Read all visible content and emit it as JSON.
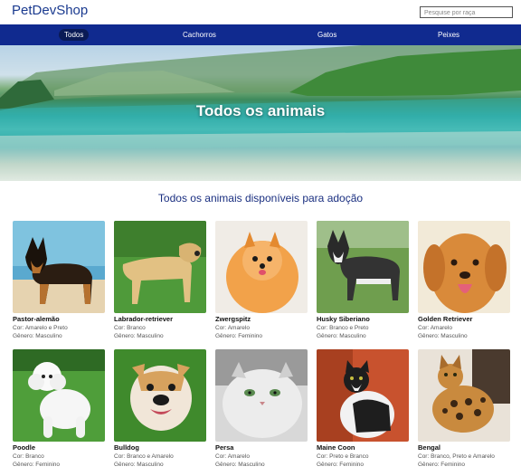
{
  "header": {
    "brand": "PetDevShop",
    "search_placeholder": "Pesquise por raça"
  },
  "nav": {
    "items": [
      {
        "label": "Todos",
        "active": true
      },
      {
        "label": "Cachorros",
        "active": false
      },
      {
        "label": "Gatos",
        "active": false
      },
      {
        "label": "Peixes",
        "active": false
      }
    ]
  },
  "hero": {
    "title": "Todos os animais"
  },
  "section": {
    "title": "Todos os animais disponíveis para adoção"
  },
  "animals": [
    {
      "name": "Pastor-alemão",
      "color": "Cor: Amarelo e Preto",
      "gender": "Gênero: Masculino",
      "icon": "german-shepherd-photo"
    },
    {
      "name": "Labrador-retriever",
      "color": "Cor: Branco",
      "gender": "Gênero: Masculino",
      "icon": "labrador-photo"
    },
    {
      "name": "Zwergspitz",
      "color": "Cor: Amarelo",
      "gender": "Gênero: Feminino",
      "icon": "pomeranian-photo"
    },
    {
      "name": "Husky Siberiano",
      "color": "Cor: Branco e Preto",
      "gender": "Gênero: Masculino",
      "icon": "husky-photo"
    },
    {
      "name": "Golden Retriever",
      "color": "Cor: Amarelo",
      "gender": "Gênero: Masculino",
      "icon": "golden-retriever-photo"
    },
    {
      "name": "Poodle",
      "color": "Cor: Branco",
      "gender": "Gênero: Feminino",
      "icon": "poodle-photo"
    },
    {
      "name": "Bulldog",
      "color": "Cor: Branco e Amarelo",
      "gender": "Gênero: Masculino",
      "icon": "bulldog-photo"
    },
    {
      "name": "Persa",
      "color": "Cor: Amarelo",
      "gender": "Gênero: Masculino",
      "icon": "persian-cat-photo"
    },
    {
      "name": "Maine Coon",
      "color": "Cor: Preto e Branco",
      "gender": "Gênero: Feminino",
      "icon": "maine-coon-photo"
    },
    {
      "name": "Bengal",
      "color": "Cor: Branco, Preto e Amarelo",
      "gender": "Gênero: Feminino",
      "icon": "bengal-cat-photo"
    }
  ],
  "colors": {
    "nav_bg": "#102a8f",
    "brand": "#1a3a8f",
    "section_title": "#1a2f80"
  }
}
